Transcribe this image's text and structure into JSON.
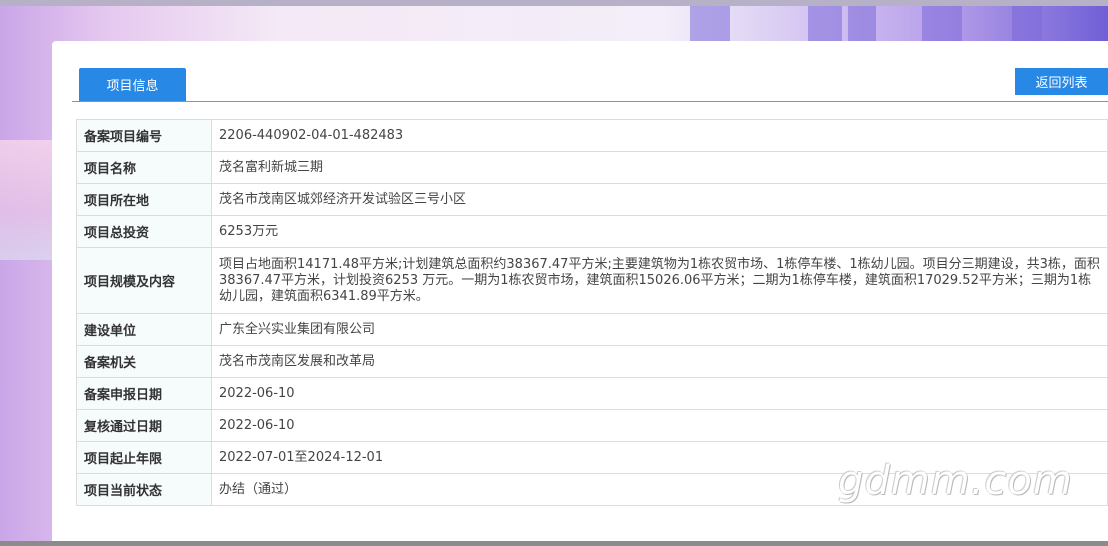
{
  "tab": {
    "label": "项目信息"
  },
  "back_button": {
    "label": "返回列表"
  },
  "rows": [
    {
      "key": "备案项目编号",
      "value": "2206-440902-04-01-482483"
    },
    {
      "key": "项目名称",
      "value": "茂名富利新城三期"
    },
    {
      "key": "项目所在地",
      "value": "茂名市茂南区城郊经济开发试验区三号小区"
    },
    {
      "key": "项目总投资",
      "value": "6253万元"
    },
    {
      "key": "项目规模及内容",
      "value": "项目占地面积14171.48平方米;计划建筑总面积约38367.47平方米;主要建筑物为1栋农贸市场、1栋停车楼、1栋幼儿园。项目分三期建设，共3栋，面积38367.47平方米，计划投资6253 万元。一期为1栋农贸市场，建筑面积15026.06平方米；二期为1栋停车楼，建筑面积17029.52平方米；三期为1栋幼儿园，建筑面积6341.89平方米。"
    },
    {
      "key": "建设单位",
      "value": "广东全兴实业集团有限公司"
    },
    {
      "key": "备案机关",
      "value": "茂名市茂南区发展和改革局"
    },
    {
      "key": "备案申报日期",
      "value": "2022-06-10"
    },
    {
      "key": "复核通过日期",
      "value": "2022-06-10"
    },
    {
      "key": "项目起止年限",
      "value": "2022-07-01至2024-12-01"
    },
    {
      "key": "项目当前状态",
      "value": "办结（通过）"
    }
  ],
  "watermark": "gdmm.com"
}
